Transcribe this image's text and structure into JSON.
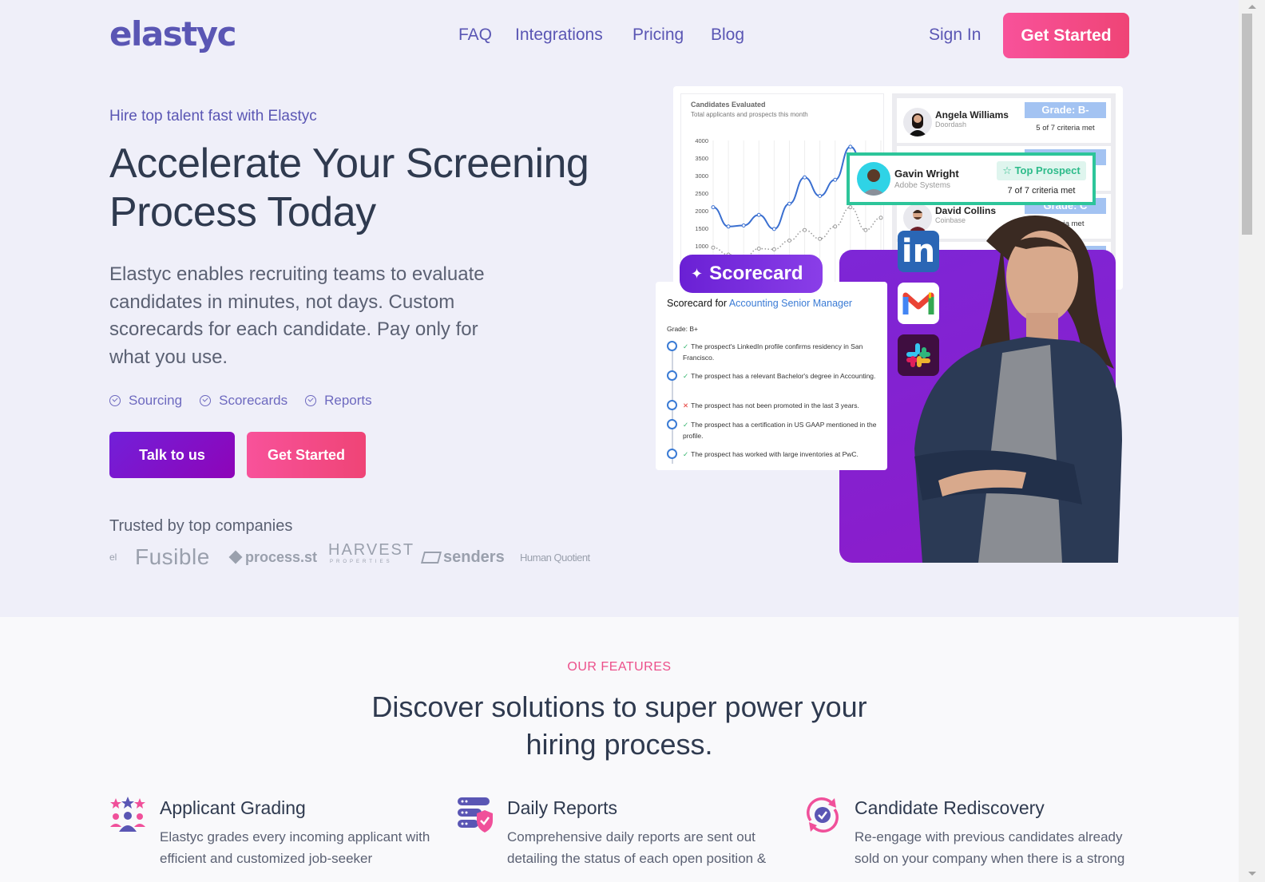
{
  "nav": {
    "logo": "elastyc",
    "links": [
      "FAQ",
      "Integrations",
      "Pricing",
      "Blog"
    ],
    "sign_in": "Sign In",
    "get_started": "Get Started"
  },
  "hero": {
    "tagline": "Hire top talent fast with Elastyc",
    "headline": "Accelerate Your Screening Process Today",
    "lead": "Elastyc enables recruiting teams to evaluate candidates in minutes, not days. Custom scorecards for each candidate. Pay only for what you use.",
    "chips": [
      "Sourcing",
      "Scorecards",
      "Reports"
    ],
    "talk_button": "Talk to us",
    "get_started_button": "Get Started",
    "trusted_label": "Trusted by top companies",
    "logos": [
      "el",
      "Fusible",
      "process.st",
      "HARVEST",
      "PROPERTIES",
      "senders",
      "Human Quotient"
    ]
  },
  "chart_card": {
    "title": "Candidates Evaluated",
    "subtitle": "Total applicants and prospects this month",
    "chart_data": {
      "type": "line",
      "title": "Candidates Evaluated",
      "subtitle": "Total applicants and prospects this month",
      "y_ticks": [
        1000,
        1500,
        2000,
        2500,
        3000,
        3500,
        4000
      ],
      "ylim": [
        1000,
        4000
      ],
      "grid": true,
      "series": [
        {
          "name": "applicants",
          "style": "solid",
          "color": "#3a6fd0",
          "values": [
            2100,
            1550,
            1580,
            1880,
            1480,
            2200,
            2950,
            2420,
            2880,
            3820,
            3100
          ]
        },
        {
          "name": "prospects",
          "style": "dotted",
          "color": "#9a9a9a",
          "values": [
            950,
            750,
            650,
            920,
            900,
            1150,
            1450,
            1200,
            1550,
            2100,
            1450,
            1800
          ]
        }
      ]
    }
  },
  "candidates": [
    {
      "name": "Angela Williams",
      "company": "Doordash",
      "grade": "Grade: B-",
      "criteria": "5 of 7 criteria met"
    },
    {
      "name": "Gavin Wright",
      "company": "Adobe Systems",
      "badge": "Top Prospect",
      "criteria": "7 of 7 criteria met"
    },
    {
      "name": "David Collins",
      "company": "Coinbase",
      "grade": "Grade: C",
      "criteria": "criteria met"
    }
  ],
  "integrations": [
    "linkedin-icon",
    "gmail-icon",
    "slack-icon"
  ],
  "scorecard": {
    "pill": "Scorecard",
    "for_label": "Scorecard for",
    "role": "Accounting Senior Manager",
    "grade": "Grade: B+",
    "items": [
      {
        "status": "pass",
        "text": "The prospect's LinkedIn profile confirms residency in San Francisco."
      },
      {
        "status": "pass",
        "text": "The prospect has a relevant Bachelor's degree in Accounting."
      },
      {
        "status": "fail",
        "text": "The prospect has not been promoted in the last 3 years."
      },
      {
        "status": "pass",
        "text": "The prospect has a certification in US GAAP mentioned in the profile."
      },
      {
        "status": "pass",
        "text": "The prospect has worked with large inventories at PwC."
      }
    ]
  },
  "features": {
    "eyebrow": "OUR FEATURES",
    "title": "Discover solutions to super power your hiring process.",
    "items": [
      {
        "icon": "stars-people-icon",
        "title": "Applicant Grading",
        "text": "Elastyc grades every incoming applicant with efficient and customized job-seeker"
      },
      {
        "icon": "server-shield-icon",
        "title": "Daily Reports",
        "text": "Comprehensive daily reports are sent out detailing the status of each open position &"
      },
      {
        "icon": "sync-check-icon",
        "title": "Candidate Rediscovery",
        "text": "Re-engage with previous candidates already sold on your company when there is a strong"
      }
    ]
  },
  "colors": {
    "brand": "#5a56b4",
    "accent_pink": "#f8529a",
    "accent_purple": "#7220d9",
    "success": "#2dc59a",
    "heading": "#2f3a4f"
  }
}
